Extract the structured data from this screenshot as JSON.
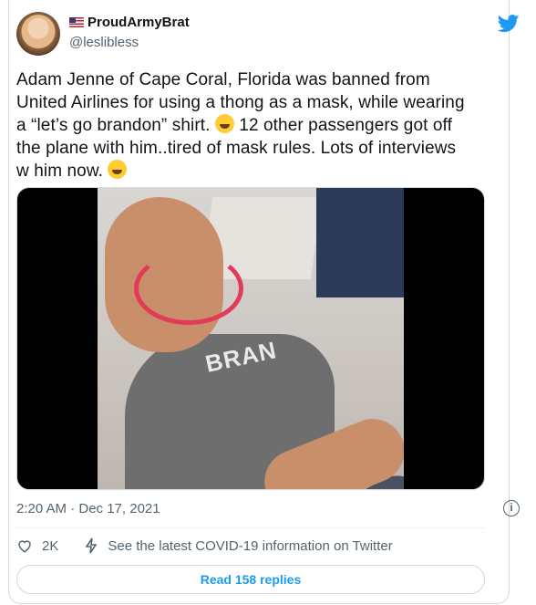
{
  "author": {
    "display_name": "ProudArmyBrat",
    "handle": "@leslibless",
    "flag_icon": "us-flag-icon",
    "avatar_icon": "avatar"
  },
  "brand_icon": "twitter-bird-icon",
  "tweet": {
    "text_line_1": "Adam Jenne of Cape Coral, Florida was banned from",
    "text_line_2": "United Airlines for using a thong as a mask, while wearing",
    "text_line_3a": "a “let’s go brandon” shirt. ",
    "text_line_3b": " 12 other passengers got off",
    "text_line_4": "the plane with him..tired of mask rules. Lots of interviews",
    "text_line_5": "w him now. ",
    "emoji_1": "laughing-tears-emoji",
    "emoji_2": "grinning-emoji"
  },
  "media": {
    "shirt_text": "BRAN"
  },
  "meta": {
    "timestamp": "2:20 AM · Dec 17, 2021",
    "info_icon": "info-icon"
  },
  "actions": {
    "like_count": "2K",
    "covid_info": "See the latest COVID-19 information on Twitter"
  },
  "replies_button": "Read 158 replies",
  "colors": {
    "accent": "#1d9bf0",
    "secondary_text": "#536471",
    "border": "#cfd9de"
  }
}
